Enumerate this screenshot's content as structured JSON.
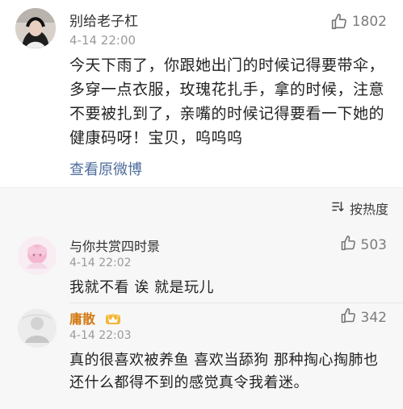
{
  "main_comment": {
    "username": "别给老子杠",
    "time": "4-14 22:00",
    "likes": "1802",
    "content": "今天下雨了，你跟她出门的时候记得要带伞，多穿一点衣服，玫瑰花扎手，拿的时候，注意不要被扎到了，亲嘴的时候记得要看一下她的健康码呀！宝贝，呜呜呜",
    "view_original": "查看原微博"
  },
  "sort": {
    "label": "按热度",
    "icon": "sort-icon"
  },
  "replies": [
    {
      "username": "与你共赏四时景",
      "time": "4-14 22:02",
      "likes": "503",
      "content": "我就不看 诶 就是玩儿"
    },
    {
      "username": "庸散",
      "time": "4-14 22:03",
      "likes": "342",
      "content": "真的很喜欢被养鱼 喜欢当舔狗 那种掏心掏肺也还什么都得不到的感觉真令我着迷。"
    }
  ],
  "colors": {
    "username_highlight": "#d47a14",
    "link": "#4e6d9c",
    "muted": "#9a9a9a",
    "reply_background": "#f7f7f7"
  }
}
